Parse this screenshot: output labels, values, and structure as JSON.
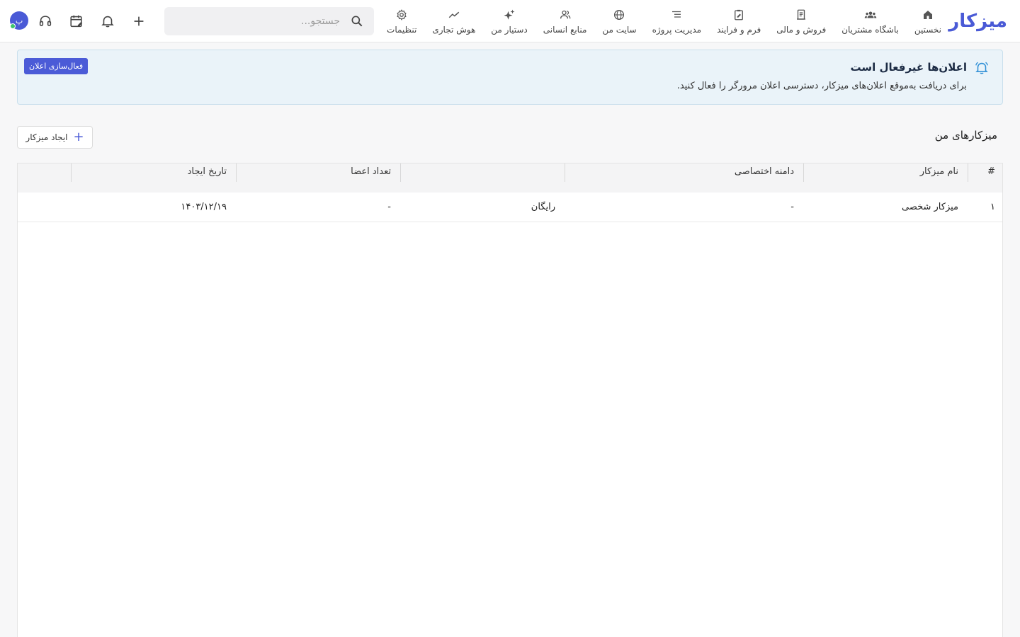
{
  "brand": {
    "logo_text": "میزکار",
    "accent": "#4a5ad6"
  },
  "nav": {
    "items": [
      {
        "label": "نخستین",
        "icon": "home-icon"
      },
      {
        "label": "باشگاه مشتریان",
        "icon": "users-group-icon"
      },
      {
        "label": "فروش و مالی",
        "icon": "receipt-icon"
      },
      {
        "label": "فرم و فرایند",
        "icon": "form-icon"
      },
      {
        "label": "مدیریت پروژه",
        "icon": "list-icon"
      },
      {
        "label": "سایت من",
        "icon": "globe-icon"
      },
      {
        "label": "منابع انسانی",
        "icon": "people-icon"
      },
      {
        "label": "دستیار من",
        "icon": "sparkle-icon"
      },
      {
        "label": "هوش تجاری",
        "icon": "trend-icon"
      },
      {
        "label": "تنظیمات",
        "icon": "gear-icon"
      }
    ]
  },
  "search": {
    "placeholder": "جستجو..."
  },
  "user": {
    "avatar_text": "پ"
  },
  "alert": {
    "title": "اعلان‌ها غیرفعال است",
    "text": "برای دریافت به‌موقع اعلان‌های میزکار، دسترسی اعلان مرورگر را فعال کنید.",
    "button": "فعال‌سازی اعلان"
  },
  "section": {
    "title": "میزکارهای من",
    "create_button": "ایجاد میزکار"
  },
  "table": {
    "headers": [
      "#",
      "نام میزکار",
      "دامنه اختصاصی",
      "",
      "تعداد اعضا",
      "تاریخ ایجاد",
      ""
    ],
    "rows": [
      [
        "۱",
        "میزکار شخصی",
        "-",
        "رایگان",
        "-",
        "۱۴۰۳/۱۲/۱۹",
        ""
      ]
    ]
  }
}
